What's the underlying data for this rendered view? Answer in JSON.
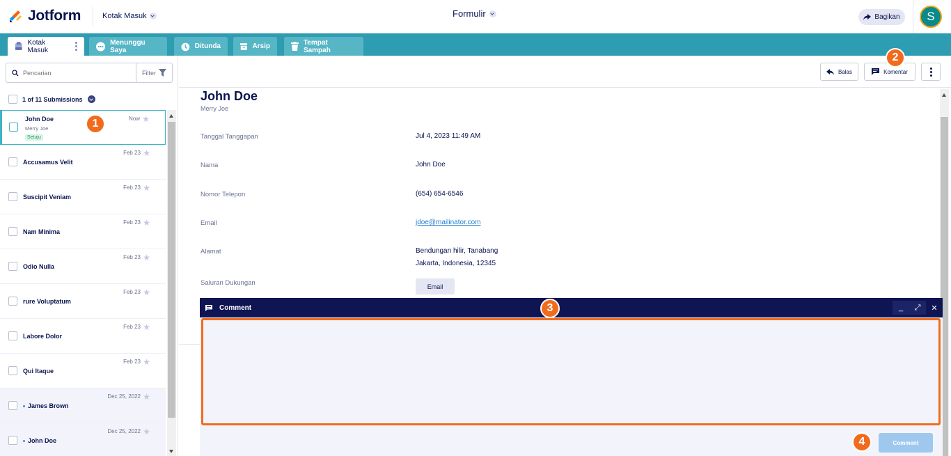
{
  "header": {
    "logo_text": "Jotform",
    "inbox_switch": "Kotak Masuk",
    "form_title": "Formulir",
    "share_label": "Bagikan",
    "avatar_initial": "S"
  },
  "tabs": [
    {
      "label": "Kotak Masuk",
      "icon": "inbox-icon"
    },
    {
      "label": "Menunggu Saya",
      "icon": "more-circle-icon"
    },
    {
      "label": "Ditunda",
      "icon": "snooze-icon"
    },
    {
      "label": "Arsip",
      "icon": "archive-icon"
    },
    {
      "label": "Tempat Sampah",
      "icon": "trash-icon"
    }
  ],
  "sidebar": {
    "search_placeholder": "Pencarian",
    "filter_label": "Filter",
    "count_label": "1 of 11 Submissions",
    "items": [
      {
        "name": "John Doe",
        "sub": "Merry Joe",
        "badge": "Setuju",
        "date": "Now"
      },
      {
        "name": "Accusamus Velit",
        "date": "Feb 23"
      },
      {
        "name": "Suscipit Veniam",
        "date": "Feb 23"
      },
      {
        "name": "Nam Minima",
        "date": "Feb 23"
      },
      {
        "name": "Odio Nulla",
        "date": "Feb 23"
      },
      {
        "name": "rure Voluptatum",
        "date": "Feb 23"
      },
      {
        "name": "Labore Dolor",
        "date": "Feb 23"
      },
      {
        "name": "Qui Itaque",
        "date": "Feb 23"
      },
      {
        "name": "James Brown",
        "date": "Dec 25, 2022"
      },
      {
        "name": "John Doe",
        "date": "Dec 25, 2022"
      }
    ]
  },
  "actions": {
    "reply_label": "Balas",
    "comment_label": "Komentar"
  },
  "submission": {
    "name": "John Doe",
    "sub": "Merry Joe",
    "fields": [
      {
        "label": "Tanggal Tanggapan",
        "value": "Jul 4, 2023 11:49 AM"
      },
      {
        "label": "Nama",
        "value": "John Doe"
      },
      {
        "label": "Nomor Telepon",
        "value": "(654) 654-6546"
      },
      {
        "label": "Email",
        "value": "jdoe@mailinator.com"
      },
      {
        "label": "Alamat",
        "value_line1": "Bendungan hilir, Tanabang",
        "value_line2": "Jakarta, Indonesia, 12345"
      },
      {
        "label": "Saluran Dukungan",
        "value": "Email"
      }
    ]
  },
  "comment_panel": {
    "title": "Comment",
    "minimize": "_",
    "expand": "⤢",
    "close": "✕",
    "send_label": "Comment"
  },
  "markers": [
    "1",
    "2",
    "3",
    "4"
  ],
  "colors": {
    "accent": "#2e9cb1",
    "brand_navy": "#0a1551",
    "highlight": "#f26b1d",
    "panel_header": "#0f1552"
  }
}
